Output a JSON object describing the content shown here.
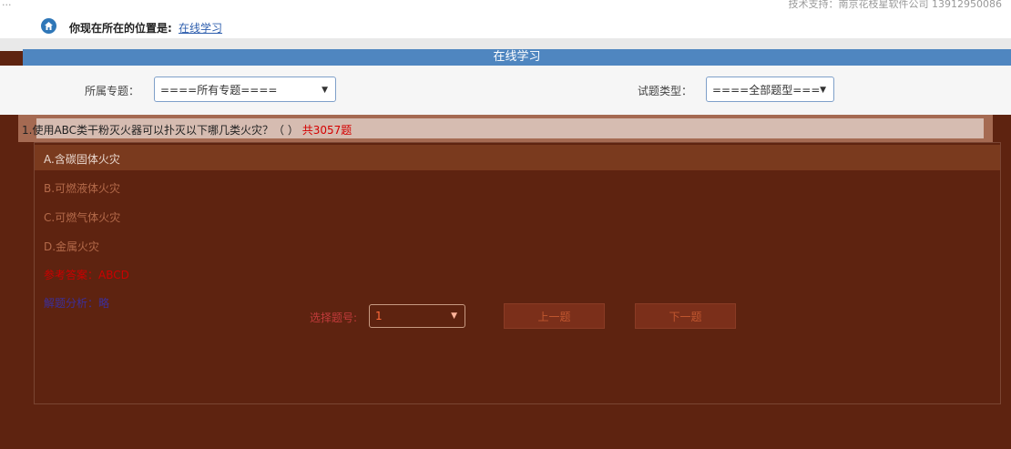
{
  "header": {
    "left_text": "...",
    "support_text": "技术支持：南京花枝星软件公司 13912950086"
  },
  "location": {
    "label": "你现在所在的位置是:",
    "current": "在线学习"
  },
  "title": "在线学习",
  "filters": {
    "topic_label": "所属专题：",
    "topic_value": "====所有专题====",
    "type_label": "试题类型：",
    "type_value": "====全部题型==="
  },
  "question": {
    "text": "1.使用ABC类干粉灭火器可以扑灭以下哪几类火灾？（ ）",
    "extra": "共3057题"
  },
  "options": [
    {
      "text": "A.含碳固体火灾",
      "color": "#e9d8cf"
    },
    {
      "text": "B.可燃液体火灾",
      "color": "#b46a4a"
    },
    {
      "text": "C.可燃气体火灾",
      "color": "#b46a4a"
    },
    {
      "text": "D.金属火灾",
      "color": "#b46a4a"
    }
  ],
  "answer": {
    "label": "参考答案：ABCD",
    "color": "#cc0000"
  },
  "analysis": {
    "label": "解题分析：略",
    "color": "#3c2f9b"
  },
  "navigation": {
    "select_label": "选择题号:",
    "select_value": "1",
    "prev_label": "上一题",
    "next_label": "下一题"
  }
}
